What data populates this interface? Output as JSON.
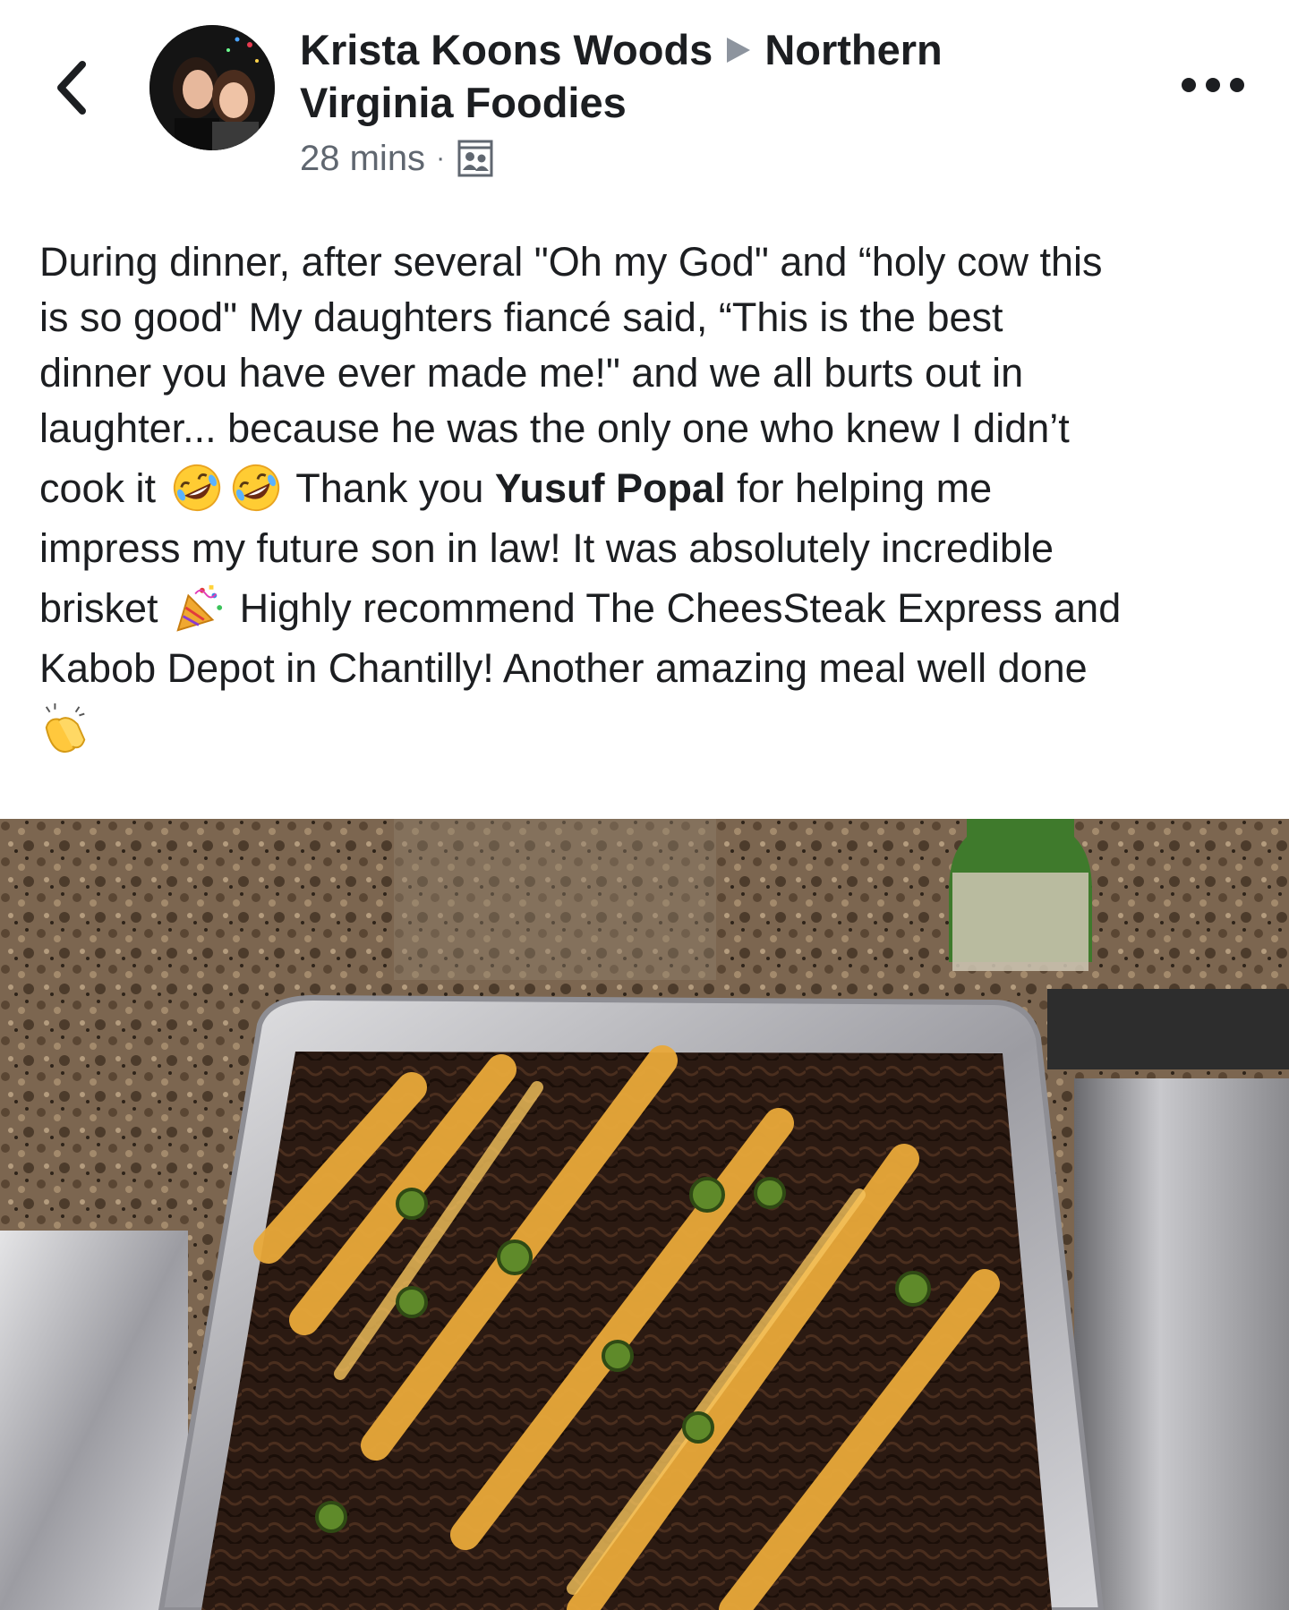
{
  "post": {
    "author_name": "Krista Koons Woods",
    "group_name_line1": "Northern",
    "group_name_line2": "Virginia Foodies",
    "timestamp": "28 mins",
    "separator": "·",
    "audience_icon": "group-audience-icon",
    "more_icon": "more-options-icon",
    "back_icon": "chevron-left-icon"
  },
  "body": {
    "line1": "During dinner, after several \"Oh my God\" and “holy cow this",
    "line2": "is so good\" My daughters fiancé said, “This is the best",
    "line3": "dinner you have ever made me!\" and we all burts out in",
    "line4": "laughter... because he was the only one who knew I didn’t",
    "line5_a": "cook it",
    "line5_b": "Thank you",
    "mention": "Yusuf Popal",
    "line5_c": "for helping me",
    "line6": "impress my future son in law! It was absolutely incredible",
    "line7_a": "brisket",
    "line7_b": "Highly recommend The CheesSteak Express and",
    "line8": "Kabob Depot in Chantilly! Another amazing meal well done",
    "emojis": [
      "rolling-on-floor-laughing-emoji",
      "rolling-on-floor-laughing-emoji",
      "party-popper-emoji",
      "clapping-hands-emoji"
    ]
  },
  "photo": {
    "subject": "brisket-tray-photo"
  }
}
